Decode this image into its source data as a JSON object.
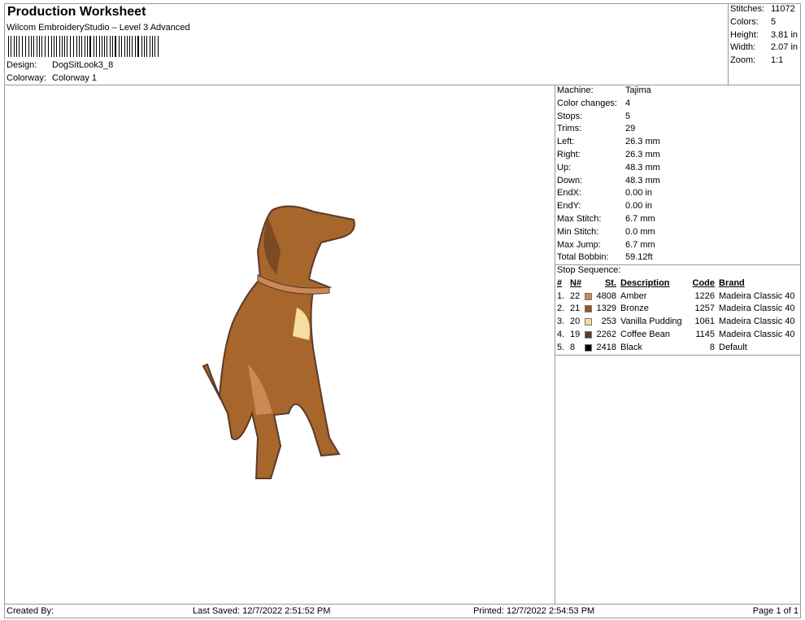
{
  "header": {
    "title": "Production Worksheet",
    "software": "Wilcom EmbroideryStudio – Level 3 Advanced",
    "design_label": "Design:",
    "design": "DogSitLook3_8",
    "colorway_label": "Colorway:",
    "colorway": "Colorway 1"
  },
  "summary": [
    {
      "k": "Stitches:",
      "v": "11072"
    },
    {
      "k": "Colors:",
      "v": "5"
    },
    {
      "k": "Height:",
      "v": "3.81 in"
    },
    {
      "k": "Width:",
      "v": "2.07 in"
    },
    {
      "k": "Zoom:",
      "v": "1:1"
    }
  ],
  "details": [
    {
      "k": "Machine:",
      "v": "Tajima"
    },
    {
      "k": "Color changes:",
      "v": "4"
    },
    {
      "k": "Stops:",
      "v": "5"
    },
    {
      "k": "Trims:",
      "v": "29"
    },
    {
      "k": "Left:",
      "v": "26.3 mm"
    },
    {
      "k": "Right:",
      "v": "26.3 mm"
    },
    {
      "k": "Up:",
      "v": "48.3 mm"
    },
    {
      "k": "Down:",
      "v": "48.3 mm"
    },
    {
      "k": "EndX:",
      "v": "0.00 in"
    },
    {
      "k": "EndY:",
      "v": "0.00 in"
    },
    {
      "k": "Max Stitch:",
      "v": "6.7 mm"
    },
    {
      "k": "Min Stitch:",
      "v": "0.0 mm"
    },
    {
      "k": "Max Jump:",
      "v": "6.7 mm"
    },
    {
      "k": "Total Bobbin:",
      "v": "59.12ft"
    }
  ],
  "stop_sequence": {
    "title": "Stop Sequence:",
    "headers": {
      "num": "#",
      "n": "N#",
      "st": "St.",
      "desc": "Description",
      "code": "Code",
      "brand": "Brand"
    },
    "rows": [
      {
        "num": "1.",
        "n": "22",
        "color": "#c98a55",
        "st": "4808",
        "desc": "Amber",
        "code": "1226",
        "brand": "Madeira Classic 40"
      },
      {
        "num": "2.",
        "n": "21",
        "color": "#9a5420",
        "st": "1329",
        "desc": "Bronze",
        "code": "1257",
        "brand": "Madeira Classic 40"
      },
      {
        "num": "3.",
        "n": "20",
        "color": "#f5dea0",
        "st": "253",
        "desc": "Vanilla Pudding",
        "code": "1061",
        "brand": "Madeira Classic 40"
      },
      {
        "num": "4.",
        "n": "19",
        "color": "#5a3a2a",
        "st": "2262",
        "desc": "Coffee Bean",
        "code": "1145",
        "brand": "Madeira Classic 40"
      },
      {
        "num": "5.",
        "n": "8",
        "color": "#000000",
        "st": "2418",
        "desc": "Black",
        "code": "8",
        "brand": "Default"
      }
    ]
  },
  "footer": {
    "created": "Created By:",
    "saved": "Last Saved: 12/7/2022 2:51:52 PM",
    "printed": "Printed: 12/7/2022 2:54:53 PM",
    "page": "Page 1 of 1"
  }
}
